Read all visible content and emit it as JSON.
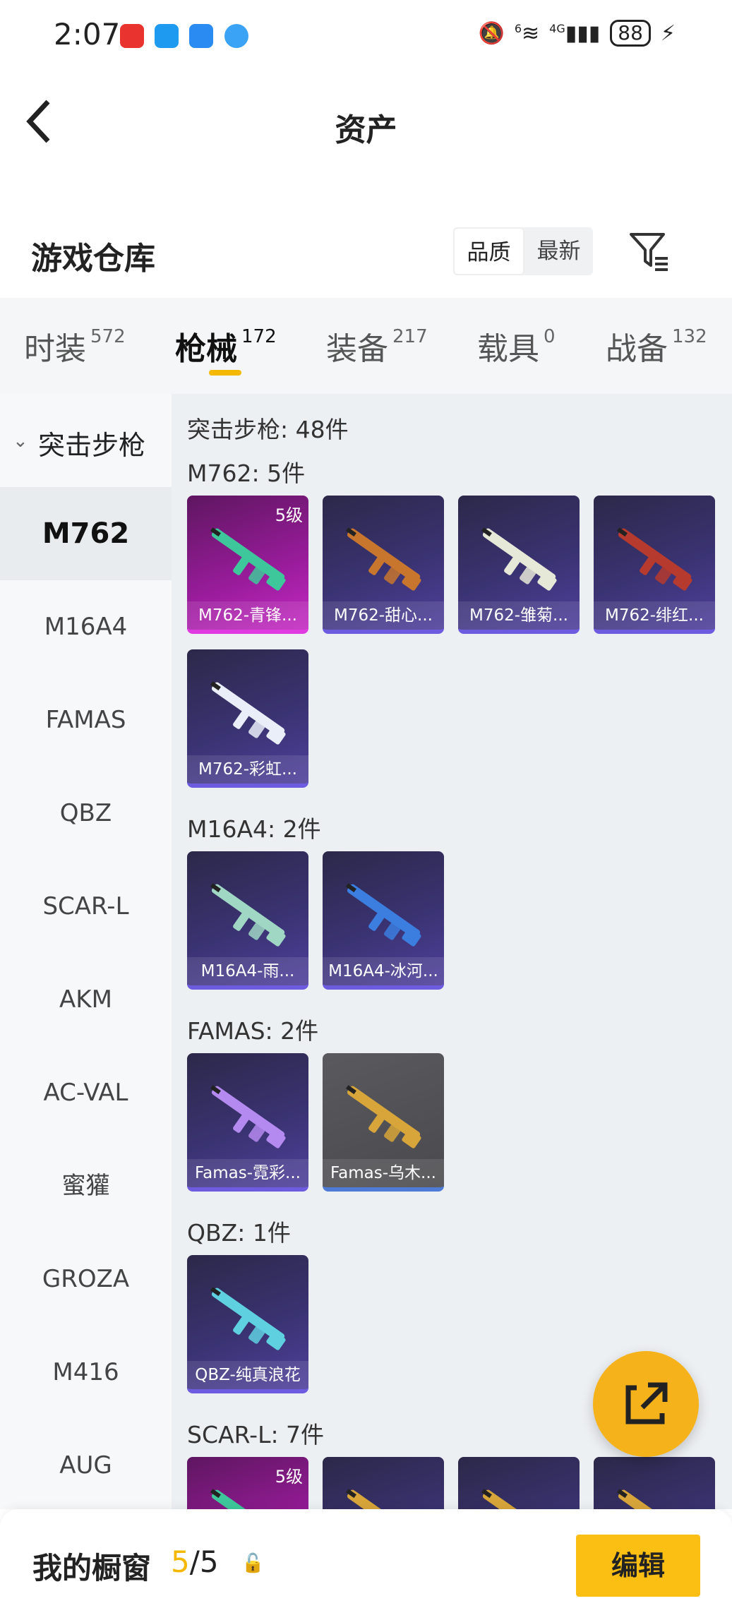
{
  "status_bar": {
    "time": "2:07",
    "signal_label": "4G",
    "wifi_label": "6",
    "battery": "88"
  },
  "header": {
    "title": "资产",
    "back_icon": "chevron-left-icon"
  },
  "warehouse": {
    "title": "游戏仓库",
    "sort_options": [
      "品质",
      "最新"
    ],
    "sort_selected": "品质",
    "filter_icon": "filter-icon"
  },
  "tabs": [
    {
      "label": "时装",
      "count": "572"
    },
    {
      "label": "枪械",
      "count": "172"
    },
    {
      "label": "装备",
      "count": "217"
    },
    {
      "label": "载具",
      "count": "0"
    },
    {
      "label": "战备",
      "count": "132"
    }
  ],
  "active_tab": "枪械",
  "sidebar": {
    "category": "突击步枪",
    "items": [
      "M762",
      "M16A4",
      "FAMAS",
      "QBZ",
      "SCAR-L",
      "AKM",
      "AC-VAL",
      "蜜獾",
      "GROZA",
      "M416",
      "AUG"
    ],
    "selected": "M762"
  },
  "main": {
    "summary": "突击步枪: 48件",
    "sections": [
      {
        "title": "M762: 5件",
        "items": [
          {
            "name": "M762-青锋...",
            "level": "5级",
            "style": "pink",
            "gun_color": "#3ec79a"
          },
          {
            "name": "M762-甜心...",
            "level": "",
            "style": "purple",
            "gun_color": "#c8762e"
          },
          {
            "name": "M762-雏菊...",
            "level": "",
            "style": "purple",
            "gun_color": "#e6e8d8"
          },
          {
            "name": "M762-绯红...",
            "level": "",
            "style": "purple",
            "gun_color": "#b63a2e"
          },
          {
            "name": "M762-彩虹...",
            "level": "",
            "style": "purple",
            "gun_color": "#e9eef8"
          }
        ]
      },
      {
        "title": "M16A4: 2件",
        "items": [
          {
            "name": "M16A4-雨...",
            "level": "",
            "style": "purple",
            "gun_color": "#9fd6c4"
          },
          {
            "name": "M16A4-冰河...",
            "level": "",
            "style": "purple",
            "gun_color": "#3b7ee0"
          }
        ]
      },
      {
        "title": "FAMAS: 2件",
        "items": [
          {
            "name": "Famas-霓彩...",
            "level": "",
            "style": "purple",
            "gun_color": "#b58af0"
          },
          {
            "name": "Famas-乌木...",
            "level": "",
            "style": "gray",
            "gun_color": "#d7a53a"
          }
        ]
      },
      {
        "title": "QBZ: 1件",
        "items": [
          {
            "name": "QBZ-纯真浪花",
            "level": "",
            "style": "purple",
            "gun_color": "#5fd0e0"
          }
        ]
      },
      {
        "title": "SCAR-L: 7件",
        "items": [
          {
            "name": "",
            "level": "5级",
            "style": "pink",
            "gun_color": "#3ec79a"
          },
          {
            "name": "",
            "level": "",
            "style": "purple",
            "gun_color": "#d7a53a"
          },
          {
            "name": "",
            "level": "",
            "style": "purple",
            "gun_color": "#d7a53a"
          },
          {
            "name": "",
            "level": "",
            "style": "purple",
            "gun_color": "#d7a53a"
          }
        ]
      }
    ]
  },
  "fab": {
    "icon": "external-link-icon"
  },
  "bottom_bar": {
    "label": "我的橱窗",
    "count_current": "5",
    "count_total": "/5",
    "lock_icon": "lock-icon",
    "edit_label": "编辑"
  }
}
